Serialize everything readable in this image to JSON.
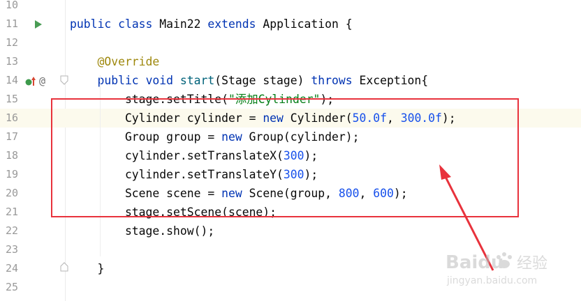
{
  "editor": {
    "lines": [
      {
        "number": "10",
        "tokens": []
      },
      {
        "number": "11",
        "tokens": [
          {
            "t": "public ",
            "c": "kw"
          },
          {
            "t": "class ",
            "c": "kw"
          },
          {
            "t": "Main22 ",
            "c": ""
          },
          {
            "t": "extends ",
            "c": "kw"
          },
          {
            "t": "Application {",
            "c": ""
          }
        ]
      },
      {
        "number": "12",
        "tokens": []
      },
      {
        "number": "13",
        "tokens": [
          {
            "t": "    @Override",
            "c": "ann"
          }
        ]
      },
      {
        "number": "14",
        "tokens": [
          {
            "t": "    public ",
            "c": "kw"
          },
          {
            "t": "void ",
            "c": "kw"
          },
          {
            "t": "start",
            "c": "fn"
          },
          {
            "t": "(Stage stage) ",
            "c": ""
          },
          {
            "t": "throws ",
            "c": "kw"
          },
          {
            "t": "Exception{",
            "c": ""
          }
        ]
      },
      {
        "number": "15",
        "tokens": [
          {
            "t": "        stage.setTitle(",
            "c": ""
          },
          {
            "t": "\"添加Cylinder\"",
            "c": "str"
          },
          {
            "t": ");",
            "c": ""
          }
        ]
      },
      {
        "number": "16",
        "current": true,
        "tokens": [
          {
            "t": "        Cylinder cylinder = ",
            "c": ""
          },
          {
            "t": "new ",
            "c": "kw"
          },
          {
            "t": "Cylinder(",
            "c": ""
          },
          {
            "t": "50.0f",
            "c": "num"
          },
          {
            "t": ", ",
            "c": ""
          },
          {
            "t": "300.0f",
            "c": "num"
          },
          {
            "t": ");",
            "c": ""
          }
        ]
      },
      {
        "number": "17",
        "tokens": [
          {
            "t": "        Group group = ",
            "c": ""
          },
          {
            "t": "new ",
            "c": "kw"
          },
          {
            "t": "Group(cylinder);",
            "c": ""
          }
        ]
      },
      {
        "number": "18",
        "tokens": [
          {
            "t": "        cylinder.setTranslateX(",
            "c": ""
          },
          {
            "t": "300",
            "c": "num"
          },
          {
            "t": ");",
            "c": ""
          }
        ]
      },
      {
        "number": "19",
        "tokens": [
          {
            "t": "        cylinder.setTranslateY(",
            "c": ""
          },
          {
            "t": "300",
            "c": "num"
          },
          {
            "t": ");",
            "c": ""
          }
        ]
      },
      {
        "number": "20",
        "tokens": [
          {
            "t": "        Scene scene = ",
            "c": ""
          },
          {
            "t": "new ",
            "c": "kw"
          },
          {
            "t": "Scene(group, ",
            "c": ""
          },
          {
            "t": "800",
            "c": "num"
          },
          {
            "t": ", ",
            "c": ""
          },
          {
            "t": "600",
            "c": "num"
          },
          {
            "t": ");",
            "c": ""
          }
        ]
      },
      {
        "number": "21",
        "tokens": [
          {
            "t": "        stage.setScene(scene);",
            "c": ""
          }
        ]
      },
      {
        "number": "22",
        "tokens": [
          {
            "t": "        stage.show();",
            "c": ""
          }
        ]
      },
      {
        "number": "23",
        "tokens": []
      },
      {
        "number": "24",
        "tokens": [
          {
            "t": "    }",
            "c": ""
          }
        ]
      },
      {
        "number": "25",
        "tokens": []
      }
    ]
  },
  "gutter_icons": {
    "run": "run-icon",
    "override": "override-icon",
    "annotation": "at-sign-icon",
    "annotation_glyph": "@"
  },
  "colors": {
    "keyword": "#0033b3",
    "number": "#1750eb",
    "string": "#067d17",
    "annotation": "#9e880d",
    "highlight_box": "#e8323c"
  },
  "watermark": {
    "brand": "Baidu",
    "brand_cn": "经验",
    "url": "jingyan.baidu.com"
  }
}
